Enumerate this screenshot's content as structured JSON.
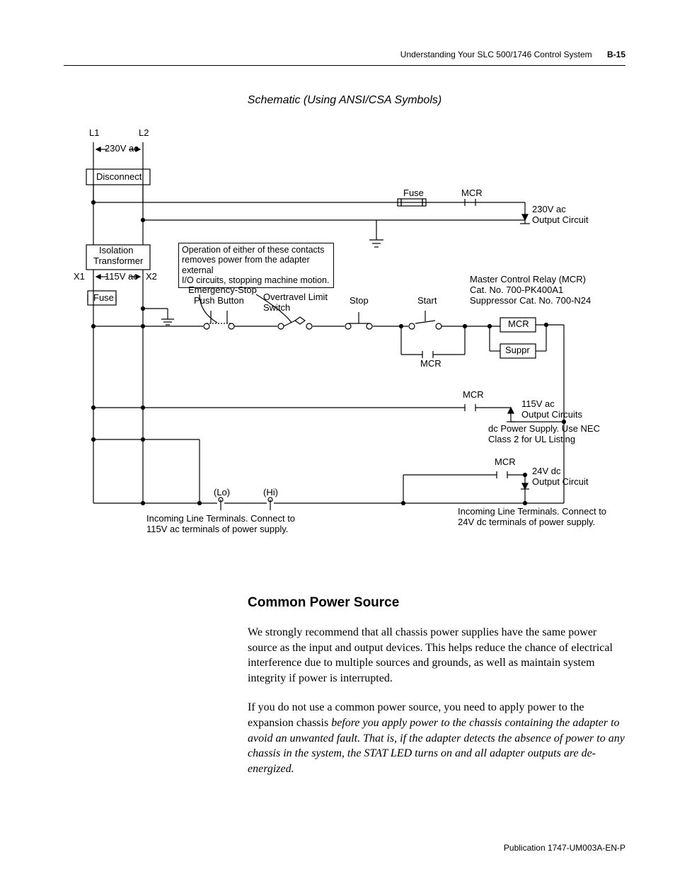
{
  "header": {
    "section": "Understanding Your SLC 500/1746 Control System",
    "pagenum": "B-15"
  },
  "caption": "Schematic (Using ANSI/CSA Symbols)",
  "diagram": {
    "L1": "L1",
    "L2": "L2",
    "v230": "230V ac",
    "disconnect": "Disconnect",
    "fuse_top": "Fuse",
    "mcr_top": "MCR",
    "out230_1": "230V ac",
    "out230_2": "Output Circuit",
    "iso1": "Isolation",
    "iso2": "Transformer",
    "opnote1": "Operation of either of these contacts",
    "opnote2": "removes power from the adapter external",
    "opnote3": "I/O circuits, stopping machine motion.",
    "X1": "X1",
    "X2": "X2",
    "v115": "115V ac",
    "fuse": "Fuse",
    "estop1": "Emergency-Stop",
    "estop2": "Push Button",
    "ovt1": "Overtravel Limit",
    "ovt2": "Switch",
    "stop": "Stop",
    "start": "Start",
    "mcr_info1": "Master Control Relay (MCR)",
    "mcr_info2": "Cat. No. 700-PK400A1",
    "mcr_info3": "Suppressor Cat. No. 700-N24",
    "mcr_box": "MCR",
    "suppr_box": "Suppr",
    "mcr_contact": "MCR",
    "mcr_mid": "MCR",
    "out115_1": "115V ac",
    "out115_2": "Output Circuits",
    "dcps1": "dc Power Supply. Use NEC",
    "dcps2": "Class 2 for UL Listing",
    "mcr_low": "MCR",
    "out24_1": "24V dc",
    "out24_2": "Output Circuit",
    "lo": "(Lo)",
    "hi": "(Hi)",
    "inc115_1": "Incoming Line Terminals. Connect to",
    "inc115_2": "115V ac terminals of power supply.",
    "inc24_1": "Incoming Line Terminals. Connect to",
    "inc24_2": "24V dc terminals of power supply."
  },
  "body": {
    "h2": "Common Power Source",
    "p1": "We strongly recommend that all chassis power supplies have the same power source as the input and output devices. This helps reduce the chance of electrical interference due to multiple sources and grounds, as well as maintain system integrity if power is interrupted.",
    "p2a": "If you do not use a common power source, you need to apply power to the expansion chassis ",
    "p2b": "before you apply power to the chassis containing the adapter to avoid an unwanted fault. That is, if the adapter detects the absence of power to any chassis in the system, the STAT LED turns on and all adapter outputs are de-energized."
  },
  "footer": "Publication 1747-UM003A-EN-P"
}
